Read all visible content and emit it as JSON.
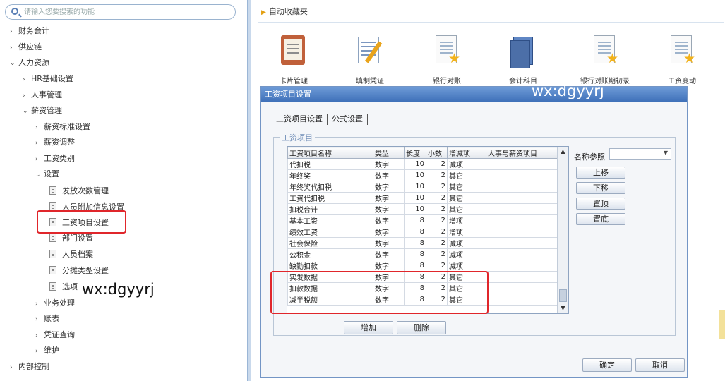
{
  "search": {
    "placeholder": "请输入您要搜索的功能"
  },
  "tree": [
    {
      "label": "财务会计",
      "arrow": "›"
    },
    {
      "label": "供应链",
      "arrow": "›"
    },
    {
      "label": "人力资源",
      "arrow": "⌄"
    },
    {
      "label": "HR基础设置",
      "arrow": "›"
    },
    {
      "label": "人事管理",
      "arrow": "›"
    },
    {
      "label": "薪资管理",
      "arrow": "⌄"
    },
    {
      "label": "薪资标准设置",
      "arrow": "›"
    },
    {
      "label": "薪资调整",
      "arrow": "›"
    },
    {
      "label": "工资类别",
      "arrow": "›"
    },
    {
      "label": "设置",
      "arrow": "⌄"
    },
    {
      "label": "发放次数管理",
      "arrow": ""
    },
    {
      "label": "人员附加信息设置",
      "arrow": ""
    },
    {
      "label": "工资项目设置",
      "arrow": ""
    },
    {
      "label": "部门设置",
      "arrow": ""
    },
    {
      "label": "人员档案",
      "arrow": ""
    },
    {
      "label": "分摊类型设置",
      "arrow": ""
    },
    {
      "label": "选项",
      "arrow": ""
    },
    {
      "label": "业务处理",
      "arrow": "›"
    },
    {
      "label": "账表",
      "arrow": "›"
    },
    {
      "label": "凭证查询",
      "arrow": "›"
    },
    {
      "label": "维护",
      "arrow": "›"
    },
    {
      "label": "内部控制",
      "arrow": "›"
    }
  ],
  "watermark": "wx:dgyyrj",
  "favorites": {
    "title": "自动收藏夹",
    "items": [
      "卡片管理",
      "填制凭证",
      "银行对账",
      "会计科目",
      "银行对账期初录",
      "工资变动"
    ]
  },
  "dialog": {
    "title": "工资项目设置",
    "tabs": [
      "工资项目设置",
      "公式设置"
    ],
    "group_title": "工资项目",
    "columns": [
      "工资项目名称",
      "类型",
      "长度",
      "小数",
      "增减项",
      "人事与薪资项目"
    ],
    "rows": [
      [
        "代扣税",
        "数字",
        "10",
        "2",
        "减项",
        ""
      ],
      [
        "年终奖",
        "数字",
        "10",
        "2",
        "其它",
        ""
      ],
      [
        "年终奖代扣税",
        "数字",
        "10",
        "2",
        "其它",
        ""
      ],
      [
        "工资代扣税",
        "数字",
        "10",
        "2",
        "其它",
        ""
      ],
      [
        "扣税合计",
        "数字",
        "10",
        "2",
        "其它",
        ""
      ],
      [
        "基本工资",
        "数字",
        "8",
        "2",
        "增项",
        ""
      ],
      [
        "绩效工资",
        "数字",
        "8",
        "2",
        "增项",
        ""
      ],
      [
        "社会保险",
        "数字",
        "8",
        "2",
        "减项",
        ""
      ],
      [
        "公积金",
        "数字",
        "8",
        "2",
        "减项",
        ""
      ],
      [
        "缺勤扣款",
        "数字",
        "8",
        "2",
        "减项",
        ""
      ],
      [
        "实发数据",
        "数字",
        "8",
        "2",
        "其它",
        ""
      ],
      [
        "扣款数据",
        "数字",
        "8",
        "2",
        "其它",
        ""
      ],
      [
        "减半税额",
        "数字",
        "8",
        "2",
        "其它",
        ""
      ]
    ],
    "name_ref_label": "名称参照",
    "side_buttons": [
      "上移",
      "下移",
      "置顶",
      "置底"
    ],
    "add_label": "增加",
    "delete_label": "删除",
    "ok_label": "确定",
    "cancel_label": "取消"
  }
}
